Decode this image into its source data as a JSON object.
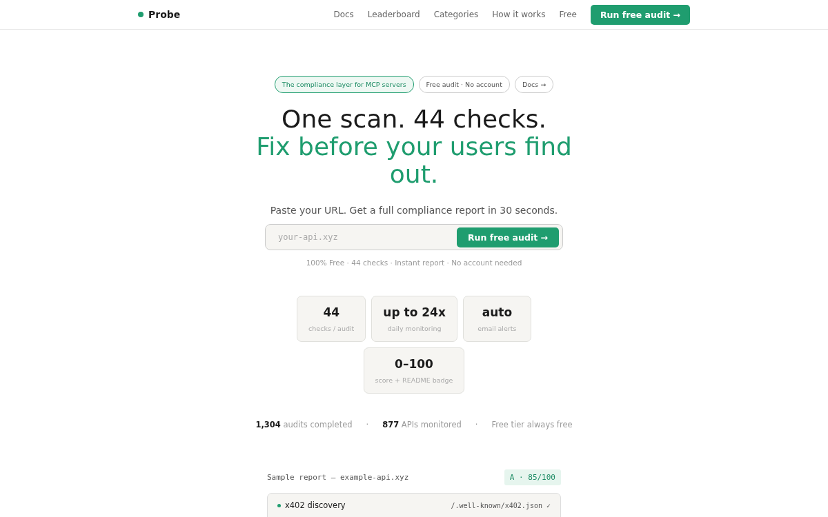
{
  "nav": {
    "brand": "Probe",
    "links": [
      "Docs",
      "Leaderboard",
      "Categories",
      "How it works",
      "Free"
    ],
    "cta": "Run free audit →"
  },
  "hero": {
    "pills": [
      {
        "text": "The compliance layer for MCP servers",
        "kind": "accent"
      },
      {
        "text": "Free audit · No account",
        "kind": "plain"
      },
      {
        "text": "Docs →",
        "kind": "plain"
      }
    ],
    "title": "One scan. 44 checks.",
    "title_accent": "Fix before your users find out.",
    "subtitle": "Paste your URL. Get a full compliance report in 30 seconds.",
    "search": {
      "placeholder": "your-api.xyz",
      "button": "Run free audit →"
    },
    "note": "100% Free · 44 checks · Instant report · No account needed"
  },
  "features": [
    {
      "value": "44",
      "label": "checks / audit"
    },
    {
      "value": "up to 24x",
      "label": "daily monitoring"
    },
    {
      "value": "auto",
      "label": "email alerts"
    },
    {
      "value": "0–100",
      "label": "score + README badge"
    }
  ],
  "stats": [
    {
      "kind": "stat",
      "text": "**1,304** audits completed"
    },
    {
      "kind": "separator",
      "text": "·"
    },
    {
      "kind": "stat",
      "text": "**877** APIs monitored"
    },
    {
      "kind": "separator",
      "text": "·"
    },
    {
      "kind": "stat",
      "text": "Free tier always free"
    }
  ],
  "report": {
    "title": "Sample report — example-api.xyz",
    "grade": "A · 85/100",
    "rows": [
      {
        "name": "x402 discovery",
        "detail": "/.well-known/x402.json ✓",
        "color": "#1f9d6f"
      }
    ]
  }
}
